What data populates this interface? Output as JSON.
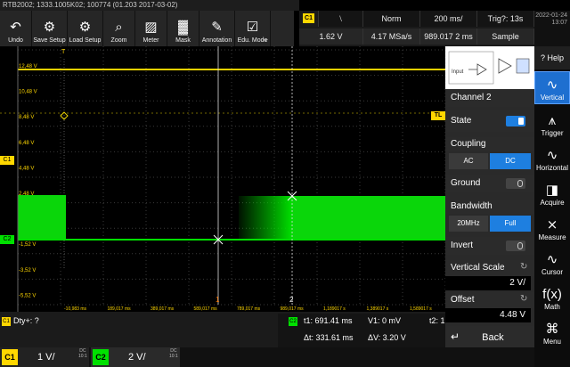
{
  "title": "RTB2002; 1333.1005K02; 100774 (01.203 2017-03-02)",
  "toolbar": {
    "undo": "Undo",
    "save_setup": "Save Setup",
    "load_setup": "Load Setup",
    "zoom": "Zoom",
    "meter": "Meter",
    "mask": "Mask",
    "annotation": "Annotation",
    "edu_mode": "Edu. Mode"
  },
  "trigger": {
    "channel": "C1",
    "slope": "⧵",
    "mode": "Norm",
    "timebase": "200 ms/",
    "status": "Trig?: 13s",
    "level": "1.62 V",
    "sample_rate": "4.17 MSa/s",
    "position": "989.017 2 ms",
    "acq_mode": "Sample"
  },
  "datetime": {
    "date": "2022-01-24",
    "time": "13:07"
  },
  "help": "Help",
  "panel": {
    "title": "Channel 2",
    "state_label": "State",
    "coupling_label": "Coupling",
    "coupling_options": [
      "AC",
      "DC"
    ],
    "coupling_selected": "DC",
    "ground_label": "Ground",
    "bandwidth_label": "Bandwidth",
    "bandwidth_options": [
      "20MHz",
      "Full"
    ],
    "bandwidth_selected": "Full",
    "invert_label": "Invert",
    "vertical_scale_label": "Vertical Scale",
    "vertical_scale_value": "2 V/",
    "offset_label": "Offset",
    "offset_value": "4.48 V",
    "back_label": "Back"
  },
  "nav": [
    {
      "label": "Vertical",
      "icon": "vertical-icon",
      "active": true
    },
    {
      "label": "Trigger",
      "icon": "trigger-icon",
      "active": false
    },
    {
      "label": "Horizontal",
      "icon": "horizontal-icon",
      "active": false
    },
    {
      "label": "Acquire",
      "icon": "acquire-icon",
      "active": false
    },
    {
      "label": "Measure",
      "icon": "measure-icon",
      "active": false
    },
    {
      "label": "Cursor",
      "icon": "cursor-icon",
      "active": false
    },
    {
      "label": "Math",
      "icon": "math-icon",
      "active": false
    },
    {
      "label": "Menu",
      "icon": "menu-icon",
      "active": false
    }
  ],
  "screen": {
    "y_labels": [
      "12,48 V",
      "10,48 V",
      "8,48 V",
      "6,48 V",
      "4,48 V",
      "2,48 V",
      "0,48 V",
      "-1,52 V",
      "-3,52 V",
      "-5,52 V"
    ],
    "x_labels": [
      "-10,983 ms",
      "189,017 ms",
      "389,017 ms",
      "589,017 ms",
      "789,017 ms",
      "989,017 ms",
      "1,189017 s",
      "1,389017 s",
      "1,589017 s"
    ],
    "tl_label": "TL",
    "c1_marker": "C1",
    "c2_marker": "C2",
    "t_marker": "T",
    "cursor1_marker": "1",
    "cursor2_marker": "2"
  },
  "measurement": {
    "badge": "C1",
    "text": "Dty+: ?"
  },
  "cursors": {
    "badge": "C2",
    "t1": "t1: 691.41 ms",
    "v1": "V1: 0 mV",
    "t2": "t2: 1",
    "dt": "Δt: 331.61 ms",
    "dv": "ΔV: 3.20 V"
  },
  "channels": [
    {
      "name": "C1",
      "scale": "1 V/",
      "coupling": "DC",
      "bw": "10:1",
      "color": "#ffd700"
    },
    {
      "name": "C2",
      "scale": "2 V/",
      "coupling": "DC",
      "bw": "10:1",
      "color": "#00e000"
    }
  ],
  "colors": {
    "ch1": "#ffd700",
    "ch2": "#00e000",
    "accent": "#1e7fe0"
  }
}
